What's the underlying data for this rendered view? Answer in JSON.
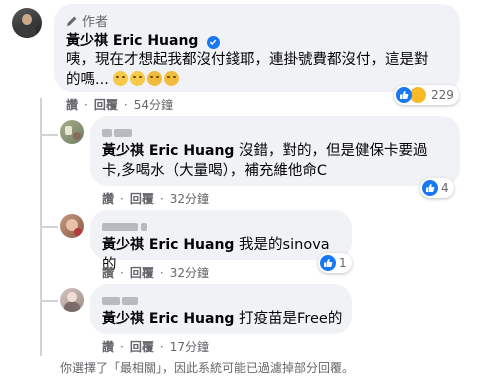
{
  "main_comment": {
    "badge": "作者",
    "author": "黃少祺 Eric Huang",
    "text_line1": "咦，現在才想起我都沒付錢耶，連掛號費都沒付，這是對",
    "text_line2": "的嗎...",
    "like_label": "讚",
    "reply_label": "回覆",
    "time": "54分鐘",
    "reaction_count": "229"
  },
  "replies": [
    {
      "mention": "黃少祺 Eric Huang",
      "text_line1": "沒錯，對的，但是健保卡要過",
      "text_line2": "卡,多喝水（大量喝），補充維他命C",
      "like_label": "讚",
      "reply_label": "回覆",
      "time": "32分鐘",
      "reaction_count": "4"
    },
    {
      "mention": "黃少祺 Eric Huang",
      "text_line1": "我是的sinova 的",
      "like_label": "讚",
      "reply_label": "回覆",
      "time": "32分鐘",
      "reaction_count": "1"
    },
    {
      "mention": "黃少祺 Eric Huang",
      "text_line1": "打疫苗是Free的",
      "like_label": "讚",
      "reply_label": "回覆",
      "time": "17分鐘"
    }
  ],
  "footer_note": "你選擇了「最相關」，因此系統可能已過濾掉部分回覆。",
  "colors": {
    "brand_blue": "#1877f2",
    "bubble_bg": "#f0f2f5",
    "meta_gray": "#65676b"
  }
}
